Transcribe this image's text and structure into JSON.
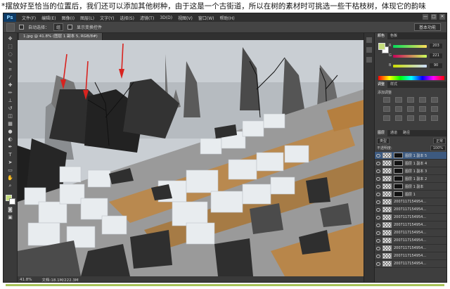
{
  "caption": "*摆放好至恰当的位置后，我们还可以添加其他树种，由于这是一个古街道，所以在树的素材时可挑选一些干枯枝树，体现它的韵味",
  "app": {
    "logo": "Ps",
    "menus": [
      "文件(F)",
      "编辑(E)",
      "图像(I)",
      "图层(L)",
      "文字(Y)",
      "选择(S)",
      "滤镜(T)",
      "3D(D)",
      "视图(V)",
      "窗口(W)",
      "帮助(H)"
    ],
    "window_controls": [
      "—",
      "□",
      "✕"
    ]
  },
  "options": {
    "auto_select_label": "自动选择：",
    "auto_select_value": "组",
    "show_transform_label": "显示变换控件",
    "workspace": "基本功能"
  },
  "document": {
    "tab": "1.jpg @ 41.8% (图层 1 副本 5, RGB/8#)",
    "zoom": "41.8%",
    "doc_info": "文档:18.1M/222.3M"
  },
  "panels": {
    "color_tabs": [
      "颜色",
      "色板"
    ],
    "color_values": {
      "r": "203",
      "g": "221",
      "b": "90"
    },
    "color_labels": {
      "r": "R",
      "g": "G",
      "b": "B"
    },
    "adjust_tabs": [
      "调整",
      "样式"
    ],
    "adjust_label": "添加调整",
    "layers_tabs": [
      "图层",
      "通道",
      "路径"
    ],
    "blend_mode": "正常",
    "opacity_label": "不透明度:",
    "opacity_value": "100%",
    "fill_label": "填充:",
    "fill_value": "100%",
    "kind_label": "类型"
  },
  "layers": [
    {
      "name": "图层 1 副本 5",
      "mask": true,
      "selected": true
    },
    {
      "name": "图层 1 副本 4",
      "mask": true,
      "selected": false
    },
    {
      "name": "图层 1 副本 3",
      "mask": true,
      "selected": false
    },
    {
      "name": "图层 1 副本 2",
      "mask": true,
      "selected": false
    },
    {
      "name": "图层 1 副本",
      "mask": true,
      "selected": false
    },
    {
      "name": "图层 1",
      "mask": true,
      "selected": false
    },
    {
      "name": "2007117154954...",
      "mask": false,
      "selected": false
    },
    {
      "name": "2007117154954...",
      "mask": false,
      "selected": false
    },
    {
      "name": "2007117154954...",
      "mask": false,
      "selected": false
    },
    {
      "name": "2007117154954...",
      "mask": false,
      "selected": false
    },
    {
      "name": "2007117154954...",
      "mask": false,
      "selected": false
    },
    {
      "name": "2007117154954...",
      "mask": false,
      "selected": false
    },
    {
      "name": "2007117154954...",
      "mask": false,
      "selected": false
    },
    {
      "name": "2007117154954...",
      "mask": false,
      "selected": false
    },
    {
      "name": "2007117154954...",
      "mask": false,
      "selected": false
    }
  ]
}
